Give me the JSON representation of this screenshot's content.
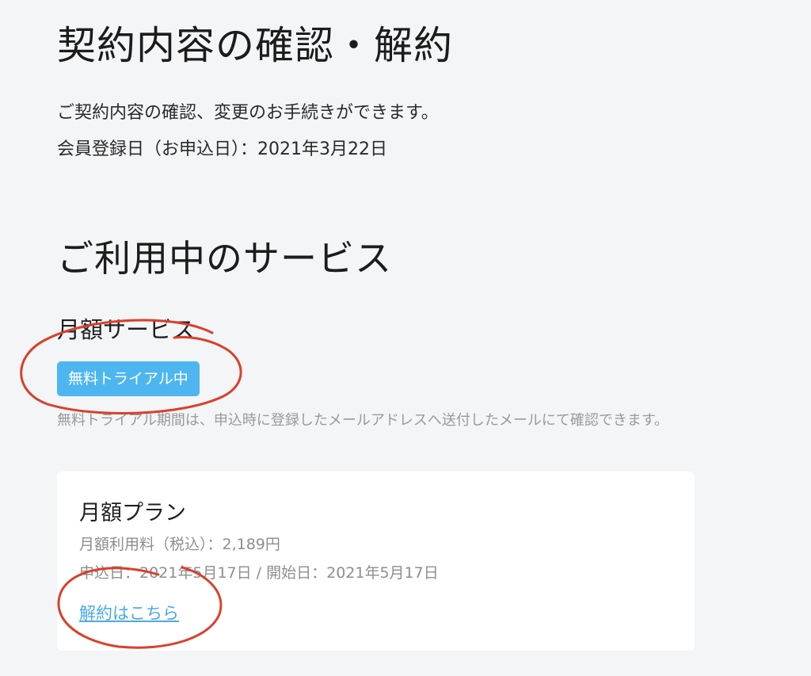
{
  "header": {
    "title": "契約内容の確認・解約",
    "description": "ご契約内容の確認、変更のお手続きができます。",
    "registration_date": "会員登録日（お申込日）：2021年3月22日"
  },
  "services": {
    "section_title": "ご利用中のサービス",
    "subsection_title": "月額サービス",
    "status_badge": "無料トライアル中",
    "trial_note": "無料トライアル期間は、申込時に登録したメールアドレスへ送付したメールにて確認できます。",
    "plan": {
      "title": "月額プラン",
      "price": "月額利用料（税込）：2,189円",
      "dates": "申込日：2021年5月17日 / 開始日：2021年5月17日",
      "cancel_link": "解約はこちら"
    }
  },
  "colors": {
    "background": "#f4f5f7",
    "badge": "#4db6f0",
    "link": "#4aa8e8",
    "annotation": "#d9402b"
  }
}
